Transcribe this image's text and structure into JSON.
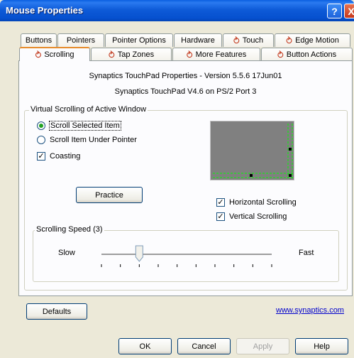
{
  "window": {
    "title": "Mouse Properties",
    "help_glyph": "?",
    "close_glyph": "X"
  },
  "tabs_row1": [
    "Buttons",
    "Pointers",
    "Pointer Options",
    "Hardware",
    "Touch",
    "Edge Motion"
  ],
  "tabs_row2": [
    "Scrolling",
    "Tap Zones",
    "More Features",
    "Button Actions"
  ],
  "active_tab": "Scrolling",
  "info": {
    "line1": "Synaptics TouchPad Properties - Version 5.5.6 17Jun01",
    "line2": "Synaptics TouchPad V4.6 on PS/2 Port 3"
  },
  "virtual_scrolling": {
    "group_label": "Virtual Scrolling of Active Window",
    "options": [
      {
        "label": "Scroll Selected Item",
        "selected": true
      },
      {
        "label": "Scroll Item Under Pointer",
        "selected": false
      }
    ],
    "coasting": {
      "label": "Coasting",
      "checked": true
    },
    "practice_label": "Practice",
    "horizontal": {
      "label": "Horizontal Scrolling",
      "checked": true
    },
    "vertical": {
      "label": "Vertical Scrolling",
      "checked": true
    },
    "preview_colors": {
      "background": "#808080",
      "scroll_zone": "#00FF00"
    }
  },
  "scrolling_speed": {
    "group_label": "Scrolling Speed (3)",
    "slow_label": "Slow",
    "fast_label": "Fast",
    "value": 3,
    "ticks": 10
  },
  "bottom": {
    "defaults_label": "Defaults",
    "link_text": "www.synaptics.com",
    "ok_label": "OK",
    "cancel_label": "Cancel",
    "apply_label": "Apply",
    "help_label": "Help"
  }
}
